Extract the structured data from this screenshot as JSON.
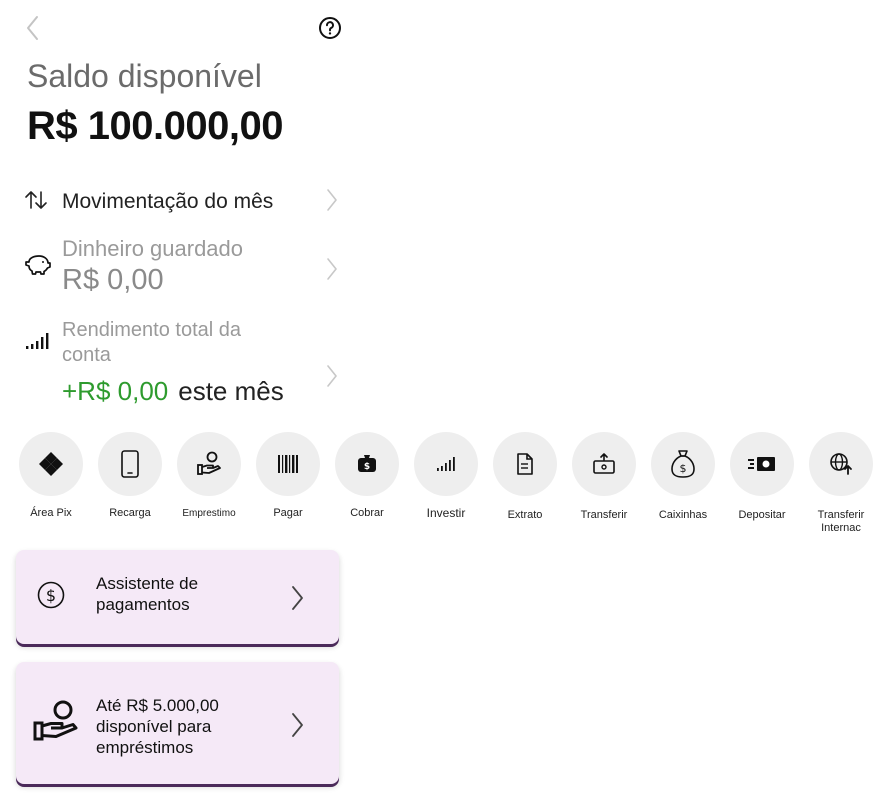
{
  "header": {
    "back_icon": "chevron-left-icon",
    "help_icon": "question-circle-icon"
  },
  "balance": {
    "label": "Saldo disponível",
    "value": "R$ 100.000,00"
  },
  "rows": {
    "movimentacao": {
      "label": "Movimentação do mês",
      "icon": "arrows-up-down-icon"
    },
    "guardado": {
      "label": "Dinheiro guardado",
      "value": "R$ 0,00",
      "icon": "piggy-bank-icon"
    },
    "rendimento": {
      "label": "Rendimento total da conta",
      "value": "+R$ 0,00",
      "suffix": "este mês",
      "icon": "signal-bars-icon",
      "value_color": "#2e9b2e"
    }
  },
  "actions": [
    {
      "label": "Área Pix",
      "icon": "pix-icon"
    },
    {
      "label": "Recarga",
      "icon": "phone-icon"
    },
    {
      "label": "Emprestimo",
      "icon": "hand-person-icon"
    },
    {
      "label": "Pagar",
      "icon": "barcode-icon"
    },
    {
      "label": "Cobrar",
      "icon": "money-bag-icon"
    },
    {
      "label": "Investir",
      "icon": "signal-bars-icon"
    },
    {
      "label": "Extrato",
      "icon": "document-icon"
    },
    {
      "label": "Transferir",
      "icon": "transfer-icon"
    },
    {
      "label": "Caixinhas",
      "icon": "money-sack-icon"
    },
    {
      "label": "Depositar",
      "icon": "cash-deposit-icon"
    },
    {
      "label": "Transferir Internac",
      "icon": "globe-icon"
    }
  ],
  "cards": {
    "assistente": {
      "text": "Assistente de pagamentos",
      "icon": "dollar-circle-icon"
    },
    "emprestimo": {
      "text": "Até R$ 5.000,00 disponível para empréstimos",
      "icon": "hand-person-icon"
    }
  },
  "colors": {
    "card_bg": "#f5e9f7",
    "card_shadow": "#4b2a5a",
    "action_circle": "#eeeeee",
    "positive": "#2e9b2e"
  }
}
